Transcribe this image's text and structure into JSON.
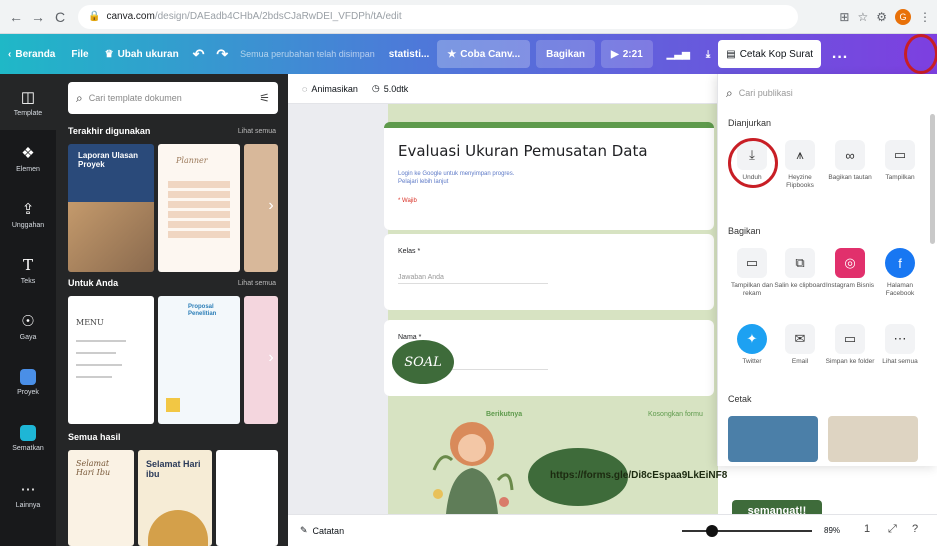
{
  "browser": {
    "url_domain": "canva.com",
    "url_path": "/design/DAEadb4CHbA/2bdsCJaRwDEI_VFDPh/tA/edit",
    "back": "←",
    "forward": "→",
    "reload": "C"
  },
  "topbar": {
    "home": "Beranda",
    "file": "File",
    "resize": "Ubah ukuran",
    "status": "Semua perubahan telah disimpan",
    "doc_title": "statisti...",
    "try_canva": "Coba Canv...",
    "share": "Bagikan",
    "present_time": "2:21",
    "print_letterhead": "Cetak Kop Surat",
    "more": "..."
  },
  "rail": [
    {
      "label": "Template",
      "icon": "template-icon"
    },
    {
      "label": "Elemen",
      "icon": "elements-icon"
    },
    {
      "label": "Unggahan",
      "icon": "upload-icon"
    },
    {
      "label": "Teks",
      "icon": "text-icon"
    },
    {
      "label": "Gaya",
      "icon": "styles-icon"
    },
    {
      "label": "Proyek",
      "icon": "projects-icon"
    },
    {
      "label": "Sematkan",
      "icon": "embed-icon"
    },
    {
      "label": "Lainnya",
      "icon": "more-icon"
    }
  ],
  "panel": {
    "search_placeholder": "Cari template dokumen",
    "recent_title": "Terakhir digunakan",
    "recent_link": "Lihat semua",
    "for_you_title": "Untuk Anda",
    "for_you_link": "Lihat semua",
    "all_results_title": "Semua hasil",
    "thumb_report": "Laporan Ulasan Proyek",
    "thumb_planner": "Planner",
    "thumb_menu": "MENU",
    "thumb_proposal": "Proposal Penelitian",
    "thumb_mothersday1": "Selamat Hari Ibu",
    "thumb_mothersday2": "Selamat Hari ibu"
  },
  "editor": {
    "animate": "Animasikan",
    "duration": "5.0dtk",
    "form_title": "Evaluasi Ukuran Pemusatan Data",
    "form_sub1": "Login ke Google untuk menyimpan progres.",
    "form_sub2": "Pelajari lebih lanjut",
    "form_required": "* Wajib",
    "q1_label": "Kelas *",
    "q1_placeholder": "Jawaban Anda",
    "q2_label": "Nama *",
    "q2_placeholder": "Jawaban Anda",
    "next": "Berikutnya",
    "clear": "Kosongkan formu",
    "soal": "SOAL",
    "link": "https://forms.gle/Di8cEspaa9LkEiNF8",
    "semangat": "semangat!!",
    "notes": "Catatan",
    "zoom": "89%",
    "page_count": "1"
  },
  "share": {
    "search_placeholder": "Cari publikasi",
    "recommended": "Dianjurkan",
    "rec_items": [
      {
        "label": "Unduh",
        "icon": "download-icon"
      },
      {
        "label": "Heyzine Flipbooks",
        "icon": "heyzine-icon"
      },
      {
        "label": "Bagikan tautan",
        "icon": "link-icon"
      },
      {
        "label": "Tampilkan",
        "icon": "present-icon"
      }
    ],
    "share_title": "Bagikan",
    "share_items": [
      {
        "label": "Tampilkan dan rekam",
        "icon": "record-icon"
      },
      {
        "label": "Salin ke clipboard",
        "icon": "copy-icon"
      },
      {
        "label": "Instagram Bisnis",
        "icon": "instagram-icon"
      },
      {
        "label": "Halaman Facebook",
        "icon": "facebook-icon"
      },
      {
        "label": "Twitter",
        "icon": "twitter-icon"
      },
      {
        "label": "Email",
        "icon": "email-icon"
      },
      {
        "label": "Simpan ke folder",
        "icon": "folder-icon"
      },
      {
        "label": "Lihat semua",
        "icon": "more-icon"
      }
    ],
    "print_title": "Cetak"
  },
  "colors": {
    "accent_red": "#c81e25",
    "brand_gradient_start": "#1fb8c7",
    "brand_gradient_end": "#7d3fe0",
    "form_green": "#5e9a4c"
  }
}
